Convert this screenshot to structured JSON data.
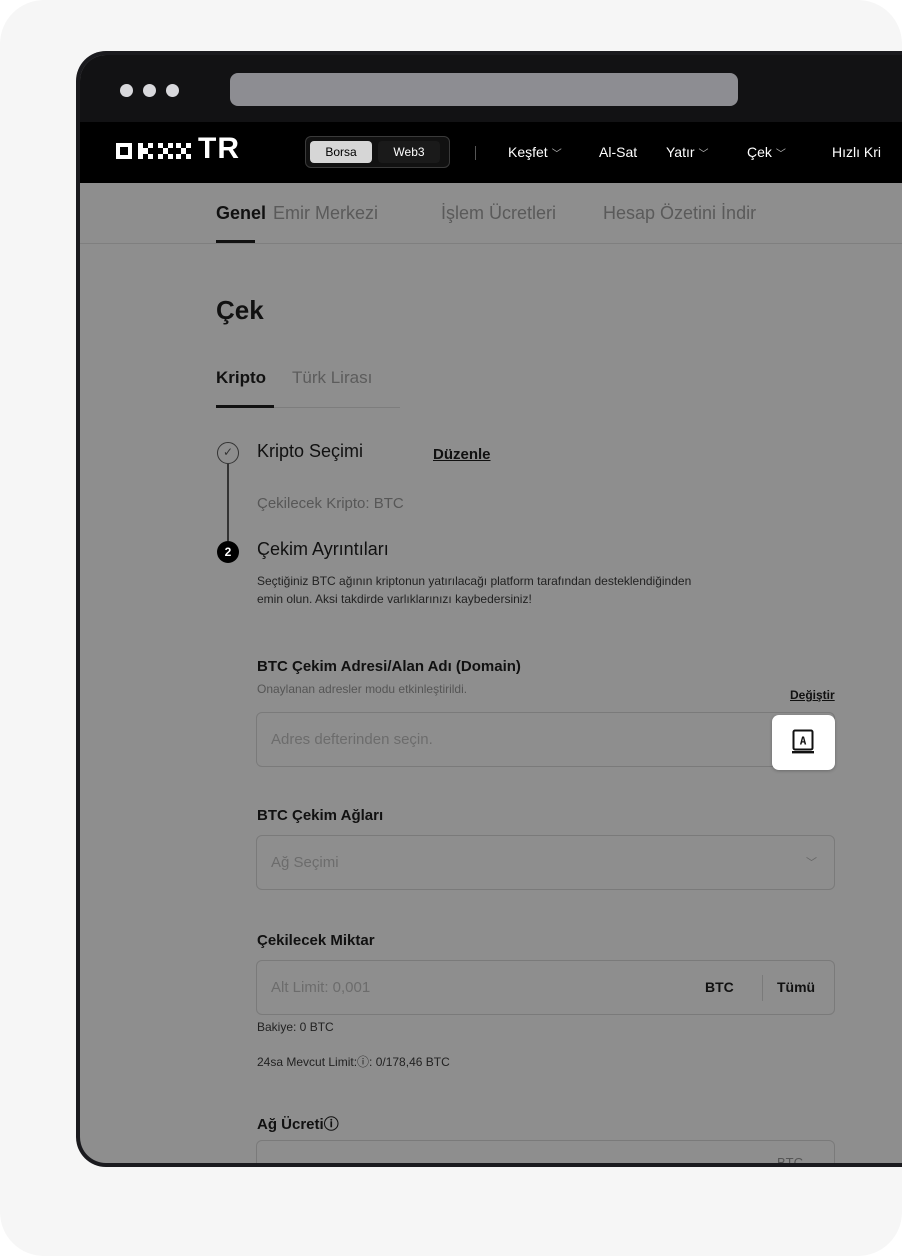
{
  "site": {
    "logo_text": "OKX",
    "logo_suffix": "TR",
    "segment": [
      "Borsa",
      "Web3"
    ],
    "nav": [
      {
        "label": "Keşfet",
        "has_dropdown": true
      },
      {
        "label": "Al-Sat",
        "has_dropdown": false
      },
      {
        "label": "Yatır",
        "has_dropdown": true
      },
      {
        "label": "Çek",
        "has_dropdown": true
      },
      {
        "label": "Hızlı Kri",
        "has_dropdown": false
      }
    ]
  },
  "subtabs": [
    "Genel",
    "Emir Merkezi",
    "İşlem Ücretleri",
    "Hesap Özetini İndir"
  ],
  "page": {
    "title": "Çek",
    "kind_tabs": [
      "Kripto",
      "Türk Lirası"
    ]
  },
  "step1": {
    "title": "Kripto Seçimi",
    "edit_link": "Düzenle",
    "detail": "Çekilecek Kripto: BTC"
  },
  "step2": {
    "number": "2",
    "title": "Çekim Ayrıntıları",
    "warning_line1": "Seçtiğiniz BTC ağının kriptonun yatırılacağı platform tarafından desteklendiğinden",
    "warning_line2": "emin olun. Aksi takdirde varlıklarınızı kaybedersiniz!"
  },
  "address": {
    "label": "BTC Çekim Adresi/Alan Adı (Domain)",
    "note": "Onaylanan adresler modu etkinleştirildi.",
    "change_link": "Değiştir",
    "placeholder": "Adres defterinden seçin."
  },
  "network": {
    "label": "BTC Çekim Ağları",
    "placeholder": "Ağ Seçimi"
  },
  "amount": {
    "label": "Çekilecek Miktar",
    "placeholder": "Alt Limit: 0,001",
    "unit": "BTC",
    "all_button": "Tümü",
    "balance": "Bakiye: 0 BTC",
    "limit": "24sa Mevcut Limit:ⓘ: 0/178,46 BTC"
  },
  "fee": {
    "label": "Ağ Ücreti",
    "info_icon": "ⓘ",
    "unit_partial": "BTC"
  },
  "colors": {
    "nav_bg": "#000000",
    "overlay": "#8e8e8e",
    "highlight": "#ffffff"
  }
}
